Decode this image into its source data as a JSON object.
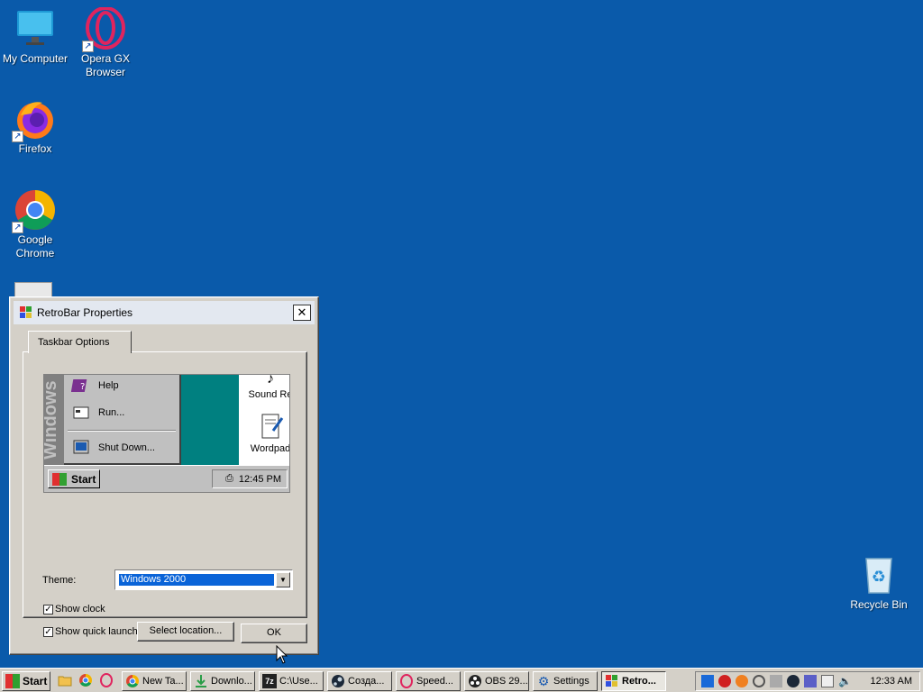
{
  "desktop": {
    "icons": [
      {
        "label": "My Computer",
        "icon": "monitor-icon"
      },
      {
        "label": "Opera GX Browser",
        "icon": "opera-gx-icon"
      },
      {
        "label": "Firefox",
        "icon": "firefox-icon"
      },
      {
        "label": "Google Chrome",
        "icon": "chrome-icon"
      },
      {
        "label": "Recycle Bin",
        "icon": "recycle-bin-icon"
      }
    ],
    "background_color": "#0a5aaa"
  },
  "dialog": {
    "title": "RetroBar Properties",
    "close_label": "✕",
    "tab_label": "Taskbar Options",
    "preview": {
      "side_text": "Windows",
      "menu_items": [
        "Help",
        "Run...",
        "Shut Down..."
      ],
      "desktop_icons": [
        "Sound Re",
        "Wordpad"
      ],
      "start_label": "Start",
      "clock": "12:45 PM"
    },
    "theme_label": "Theme:",
    "theme_value": "Windows 2000",
    "show_clock_label": "Show clock",
    "show_clock_checked": true,
    "show_quick_launch_label": "Show quick launch",
    "show_quick_launch_checked": true,
    "select_location_label": "Select location...",
    "ok_label": "OK"
  },
  "taskbar": {
    "start_label": "Start",
    "quick_launch": [
      "folder-icon",
      "chrome-icon",
      "opera-icon"
    ],
    "buttons": [
      {
        "label": "New Ta...",
        "icon": "chrome-icon",
        "active": false
      },
      {
        "label": "Downlo...",
        "icon": "download-icon",
        "active": false
      },
      {
        "label": "C:\\Use...",
        "icon": "7zip-icon",
        "active": false
      },
      {
        "label": "Созда...",
        "icon": "steam-icon",
        "active": false
      },
      {
        "label": "Speed...",
        "icon": "opera-icon",
        "active": false
      },
      {
        "label": "OBS 29....",
        "icon": "obs-icon",
        "active": false
      },
      {
        "label": "Settings",
        "icon": "gear-icon",
        "active": false
      },
      {
        "label": "Retro...",
        "icon": "retrobar-icon",
        "active": true
      }
    ],
    "tray_icons": [
      "security-icon",
      "media-icon",
      "search-tray-icon",
      "network-off-icon",
      "usb-icon",
      "steam-tray-icon",
      "teams-icon",
      "display-icon",
      "volume-icon"
    ],
    "clock": "12:33 AM"
  }
}
